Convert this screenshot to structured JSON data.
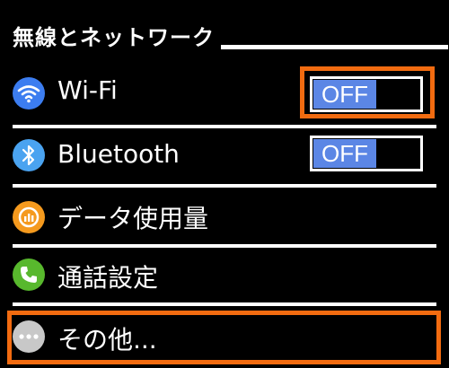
{
  "header": {
    "title": "無線とネットワーク"
  },
  "rows": {
    "wifi": {
      "label": "Wi-Fi",
      "toggle": "OFF",
      "icon": "wifi-icon",
      "color": "#3c7df0"
    },
    "bluetooth": {
      "label": "Bluetooth",
      "toggle": "OFF",
      "icon": "bluetooth-icon",
      "color": "#4aa3f0"
    },
    "data_usage": {
      "label": "データ使用量",
      "icon": "data-usage-icon",
      "color": "#f59a1e"
    },
    "call_settings": {
      "label": "通話設定",
      "icon": "phone-icon",
      "color": "#58b82d"
    },
    "more": {
      "label": "その他...",
      "icon": "more-icon",
      "color": "#c8c8c8"
    }
  },
  "colors": {
    "highlight": "#f26b10",
    "toggle_fill": "#5b86e5"
  }
}
